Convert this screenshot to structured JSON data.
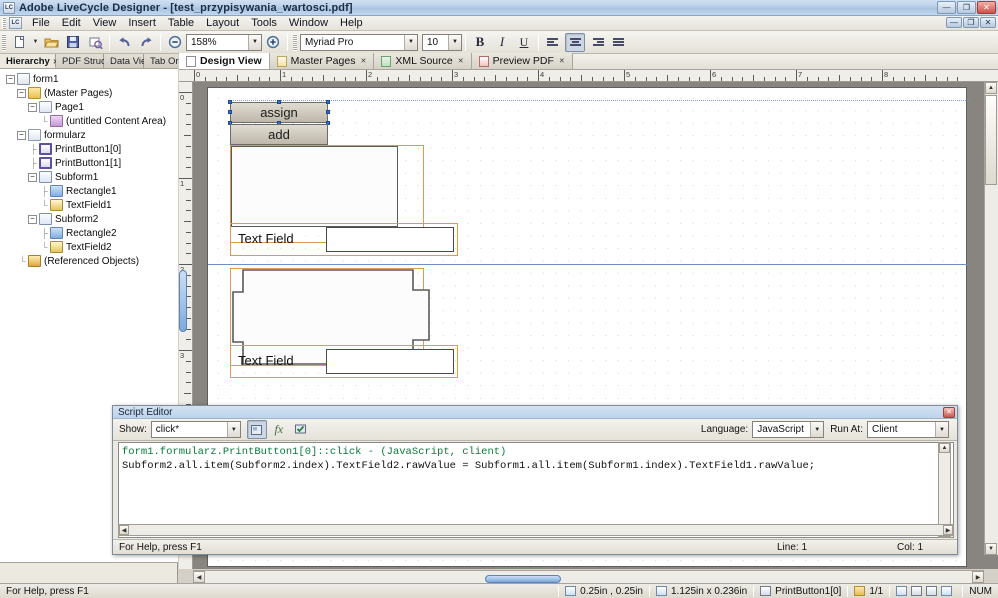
{
  "window": {
    "app_name": "Adobe LiveCycle Designer",
    "document_name": "test_przypisywania_wartosci.pdf",
    "title": "Adobe LiveCycle Designer - [test_przypisywania_wartosci.pdf]",
    "app_icon": "LC",
    "minimize": "—",
    "restore": "❐",
    "close": "✕",
    "doc_minimize": "—",
    "doc_restore": "❐",
    "doc_close": "✕"
  },
  "menu": {
    "items": [
      {
        "label": "File"
      },
      {
        "label": "Edit"
      },
      {
        "label": "View"
      },
      {
        "label": "Insert"
      },
      {
        "label": "Table"
      },
      {
        "label": "Layout"
      },
      {
        "label": "Tools"
      },
      {
        "label": "Window"
      },
      {
        "label": "Help"
      }
    ]
  },
  "toolbar": {
    "new_doc": "new-document",
    "open": "open-folder",
    "save": "save-disk",
    "print": "print-preview",
    "undo": "undo",
    "redo": "redo",
    "zoom_out": "−",
    "zoom_value": "158%",
    "zoom_in": "+",
    "font_name": "Myriad Pro",
    "font_size": "10",
    "bold": "B",
    "italic": "I",
    "underline": "U",
    "align_left": "align-left",
    "align_center": "align-center",
    "align_right": "align-right",
    "align_justify": "align-justify"
  },
  "left_panel": {
    "tabs": [
      {
        "label": "Hierarchy",
        "active": true,
        "closable": true
      },
      {
        "label": "PDF Structure",
        "active": false,
        "closable": false
      },
      {
        "label": "Data View",
        "active": false,
        "closable": false
      },
      {
        "label": "Tab Order",
        "active": false,
        "closable": false
      }
    ],
    "tree": [
      {
        "label": "form1",
        "depth": 0,
        "expander": "−",
        "icon": "form-icon"
      },
      {
        "label": "(Master Pages)",
        "depth": 1,
        "expander": "−",
        "icon": "folder-icon"
      },
      {
        "label": "Page1",
        "depth": 2,
        "expander": "−",
        "icon": "page-icon"
      },
      {
        "label": "(untitled Content Area)",
        "depth": 3,
        "expander": "",
        "icon": "content-area-icon"
      },
      {
        "label": "formularz",
        "depth": 1,
        "expander": "−",
        "icon": "page-icon"
      },
      {
        "label": "PrintButton1[0]",
        "depth": 2,
        "expander": "",
        "icon": "button-icon"
      },
      {
        "label": "PrintButton1[1]",
        "depth": 2,
        "expander": "",
        "icon": "button-icon"
      },
      {
        "label": "Subform1",
        "depth": 2,
        "expander": "−",
        "icon": "subform-icon"
      },
      {
        "label": "Rectangle1",
        "depth": 3,
        "expander": "",
        "icon": "rectangle-icon"
      },
      {
        "label": "TextField1",
        "depth": 3,
        "expander": "",
        "icon": "textfield-icon"
      },
      {
        "label": "Subform2",
        "depth": 2,
        "expander": "−",
        "icon": "subform-icon"
      },
      {
        "label": "Rectangle2",
        "depth": 3,
        "expander": "",
        "icon": "rectangle-icon"
      },
      {
        "label": "TextField2",
        "depth": 3,
        "expander": "",
        "icon": "textfield-icon"
      },
      {
        "label": "(Referenced Objects)",
        "depth": 1,
        "expander": "",
        "icon": "referenced-objects-icon"
      }
    ]
  },
  "document_tabs": [
    {
      "label": "Design View",
      "active": true,
      "closable": false,
      "icon": "design-icon"
    },
    {
      "label": "Master Pages",
      "active": false,
      "closable": true,
      "icon": "master-pages-icon"
    },
    {
      "label": "XML Source",
      "active": false,
      "closable": true,
      "icon": "xml-icon"
    },
    {
      "label": "Preview PDF",
      "active": false,
      "closable": true,
      "icon": "pdf-icon"
    }
  ],
  "rulers": {
    "horizontal_labels": [
      "0",
      "1",
      "2",
      "3",
      "4",
      "5",
      "6",
      "7",
      "8"
    ],
    "vertical_labels": [
      "0",
      "1",
      "2",
      "3"
    ],
    "unit": "in"
  },
  "canvas": {
    "buttons": [
      {
        "label": "assign",
        "selected": true
      },
      {
        "label": "add",
        "selected": false
      }
    ],
    "fields": [
      {
        "label": "Text Field",
        "value": ""
      },
      {
        "label": "Text Field",
        "value": ""
      }
    ]
  },
  "script_editor": {
    "title": "Script Editor",
    "close": "✕",
    "show_label": "Show:",
    "show_value": "click*",
    "palette_icon": "object-palette-icon",
    "fx_icon": "fx",
    "check_icon": "check-syntax-icon",
    "language_label": "Language:",
    "language_value": "JavaScript",
    "runat_label": "Run At:",
    "runat_value": "Client",
    "code_comment": "form1.formularz.PrintButton1[0]::click - (JavaScript, client)",
    "code_line": "Subform2.all.item(Subform2.index).TextField2.rawValue = Subform1.all.item(Subform1.index).TextField1.rawValue;",
    "status_help": "For Help, press F1",
    "status_line": "Line: 1",
    "status_col": "Col: 1"
  },
  "statusbar": {
    "help": "For Help, press F1",
    "position": "0.25in , 0.25in",
    "size": "1.125in x 0.236in",
    "selected_object": "PrintButton1[0]",
    "page": "1/1",
    "num_lock": "NUM",
    "view_icons": [
      "preview-icon",
      "page-icon",
      "spread-icon",
      "zoom-icon"
    ]
  },
  "colors": {
    "title_accent": "#b9cfe8",
    "selection_handle": "#2f6fd0",
    "subform_outline": "#e09a4a",
    "code_comment": "#0a7a3c",
    "panel_bg": "#ece9e1"
  }
}
